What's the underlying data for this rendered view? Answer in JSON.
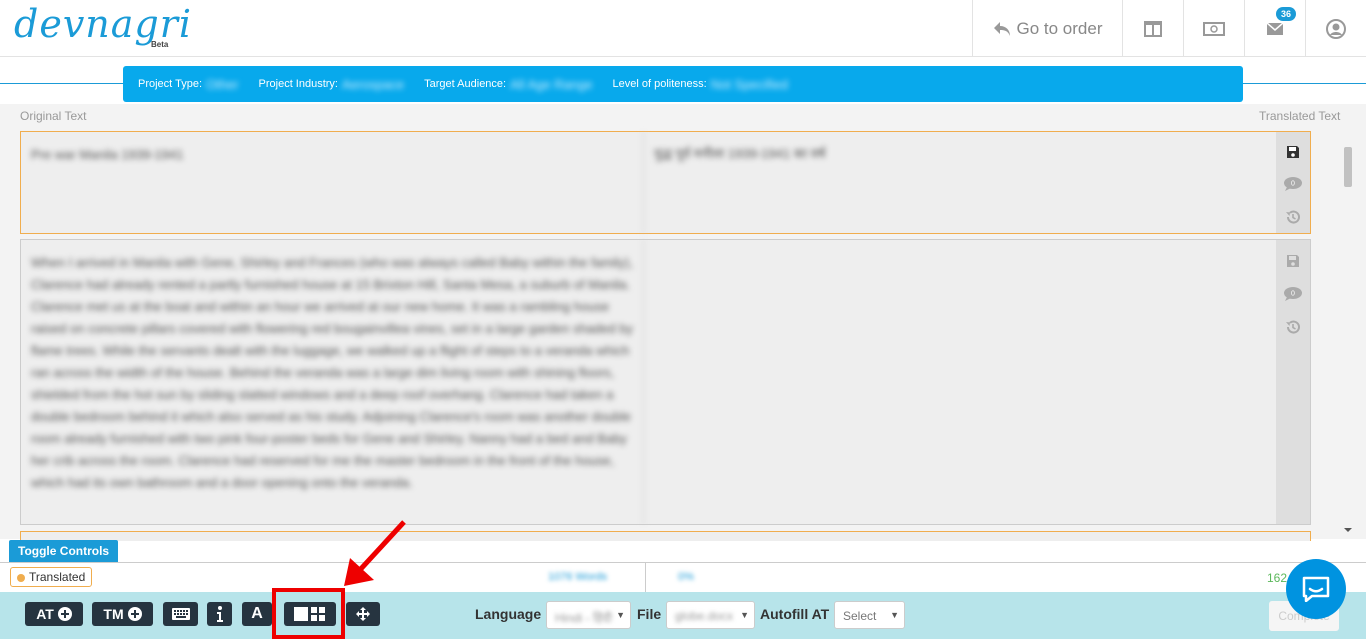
{
  "header": {
    "logo_text": "devnagri",
    "logo_beta": "Beta",
    "goto_order": "Go to order",
    "notification_count": "36",
    "icons": [
      "columns-icon",
      "money-icon",
      "mail-icon",
      "user-icon"
    ]
  },
  "infobar": {
    "project_type_label": "Project Type:",
    "project_type_value": "Other",
    "industry_label": "Project Industry:",
    "industry_value": "Aerospace",
    "audience_label": "Target Audience:",
    "audience_value": "All Age Range",
    "politeness_label": "Level of politeness:",
    "politeness_value": "Not Specified"
  },
  "columns": {
    "original": "Original Text",
    "translated": "Translated Text"
  },
  "segments": [
    {
      "source": "Pre war Manila 1939-1941",
      "target": "युद्ध पूर्व मनीला 1939-1941 का वर्ष",
      "comments": "0"
    },
    {
      "source": "When I arrived in Manila with Gene, Shirley and Frances (who was always called Baby within the family), Clarence had already rented a partly furnished house at 15 Brixton Hill, Santa Mesa, a suburb of Manila. Clarence met us at the boat and within an hour we arrived at our new home. It was a rambling house raised on concrete pillars covered with flowering red bougainvillea vines, set in a large garden shaded by flame trees. While the servants dealt with the luggage, we walked up a flight of steps to a veranda which ran across the width of the house. Behind the veranda was a large dim living room with shining floors, shielded from the hot sun by sliding slatted windows and a deep roof overhang. Clarence had taken a double bedroom behind it which also served as his study. Adjoining Clarence's room was another double room already furnished with two pink four-poster beds for Gene and Shirley. Nanny had a bed and Baby her crib across the room. Clarence had reserved for me the master bedroom in the front of the house, which had its own bathroom and a door opening onto the veranda.",
      "target": "",
      "comments": "0"
    }
  ],
  "toggle_controls": "Toggle Controls",
  "status": {
    "state": "Translated",
    "words": "1076 Words",
    "percent": "0%",
    "count": "162"
  },
  "toolbar": {
    "at_label": "AT",
    "tm_label": "TM",
    "font_label": "A",
    "language_label": "Language",
    "language_value": "Hindi - हिंदी",
    "file_label": "File",
    "file_value": "globe.docx",
    "autofill_label": "Autofill AT",
    "autofill_value": "Select",
    "complete_label": "Complete"
  },
  "colors": {
    "brand": "#1b9bd7",
    "infobar": "#08a9ec",
    "toolbar_bg": "#b7e4ea",
    "button_dark": "#263440",
    "highlight": "#e00000"
  }
}
